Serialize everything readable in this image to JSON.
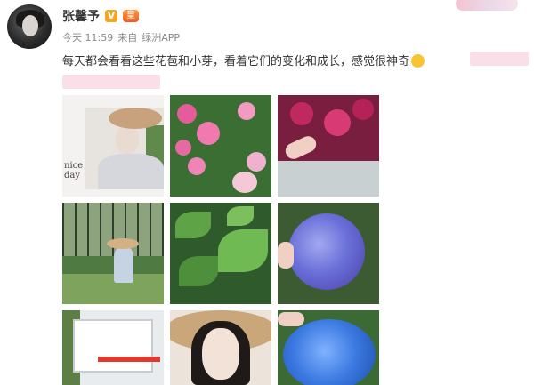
{
  "user": {
    "name": "张馨予",
    "verified_label": "V",
    "badge_label": "皇"
  },
  "post": {
    "meta": {
      "time": "今天 11:59",
      "source_prefix": "来自",
      "source_app": "绿洲APP"
    },
    "text": "每天都会看看这些花苞和小芽，看着它们的变化和成长，感觉很神奇"
  },
  "photos": [
    {
      "label": "photo-1",
      "note": "nice\nday"
    },
    {
      "label": "photo-2"
    },
    {
      "label": "photo-3"
    },
    {
      "label": "photo-4"
    },
    {
      "label": "photo-5"
    },
    {
      "label": "photo-6"
    },
    {
      "label": "photo-7"
    },
    {
      "label": "photo-8"
    },
    {
      "label": "photo-9"
    }
  ],
  "colors": {
    "name": "#333333",
    "meta": "#888888",
    "verified": "#f5a623",
    "crown": "#f05a28"
  },
  "icons": [
    "verified-icon",
    "crown-icon",
    "emoji-icon"
  ]
}
